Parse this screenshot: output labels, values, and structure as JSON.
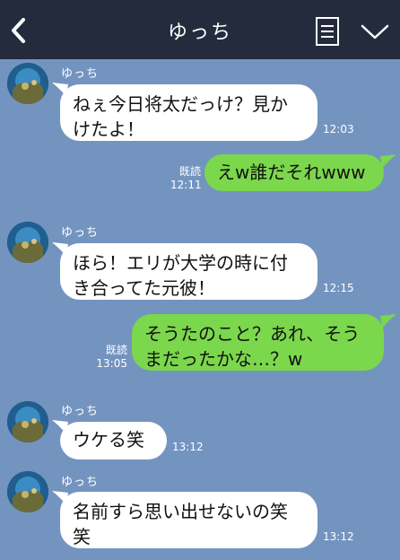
{
  "header": {
    "title": "ゆっち",
    "back_icon": "chevron-left-icon",
    "menu_icon": "note-icon",
    "expand_icon": "chevron-down-icon"
  },
  "colors": {
    "header_bg": "#232b3d",
    "chat_bg": "#7494c0",
    "incoming_bubble": "#ffffff",
    "outgoing_bubble": "#7bd74c"
  },
  "messages": [
    {
      "direction": "in",
      "sender": "ゆっち",
      "lines": [
        "ねぇ今日将太だっけ？見か",
        "けたよ！"
      ],
      "time": "12:03"
    },
    {
      "direction": "out",
      "read": "既読",
      "lines": [
        "えw誰だそれwww"
      ],
      "time": "12:11"
    },
    {
      "direction": "in",
      "sender": "ゆっち",
      "lines": [
        "ほら！エリが大学の時に付",
        "き合ってた元彼！"
      ],
      "time": "12:15"
    },
    {
      "direction": "out",
      "read": "既読",
      "lines": [
        "そうたのこと？あれ、そう",
        "まだったかな…？w"
      ],
      "time": "13:05"
    },
    {
      "direction": "in",
      "sender": "ゆっち",
      "lines": [
        "ウケる笑"
      ],
      "time": "13:12"
    },
    {
      "direction": "in",
      "sender": "ゆっち",
      "lines": [
        "名前すら思い出せないの笑",
        "笑"
      ],
      "time": "13:12"
    }
  ]
}
